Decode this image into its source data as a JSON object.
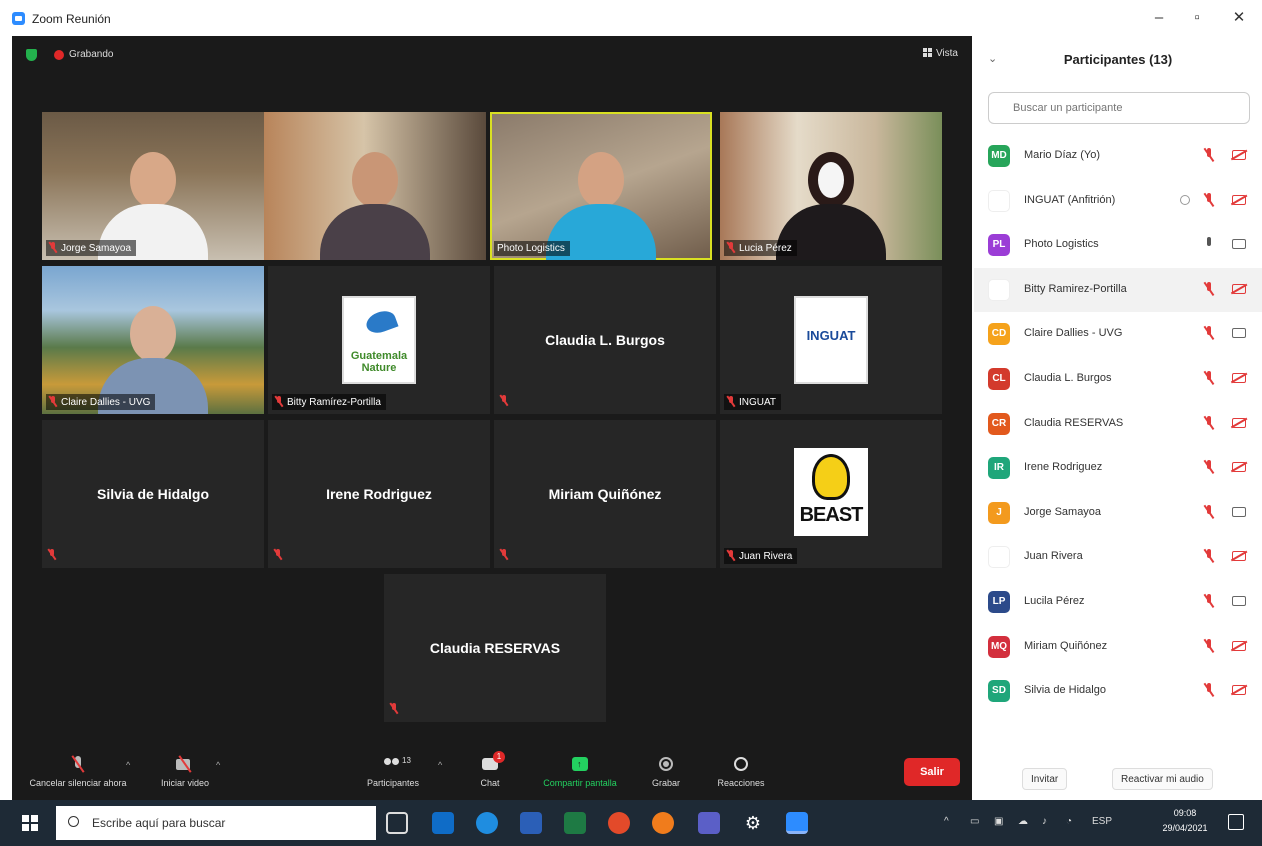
{
  "window": {
    "title": "Zoom Reunión",
    "minimize": "–",
    "restore": "▫",
    "close": "✕"
  },
  "meeting_top": {
    "recording_label": "Grabando",
    "view_label": "Vista"
  },
  "tiles": [
    {
      "name": "Jorge Samayoa",
      "kind": "video"
    },
    {
      "name": "",
      "kind": "video"
    },
    {
      "name": "Photo Logistics",
      "kind": "video",
      "active": true
    },
    {
      "name": "Lucia Pérez",
      "kind": "video"
    },
    {
      "name": "Claire Dallies - UVG",
      "kind": "video"
    },
    {
      "name": "Bitty Ramírez-Portilla",
      "kind": "logo",
      "logo_text": "Guatemala Nature"
    },
    {
      "name": "Claudia L. Burgos",
      "kind": "name"
    },
    {
      "name": "INGUAT",
      "kind": "logo",
      "logo_text": "INGUAT"
    },
    {
      "name": "Silvia de Hidalgo",
      "kind": "name"
    },
    {
      "name": "Irene Rodriguez",
      "kind": "name"
    },
    {
      "name": "Miriam Quiñónez",
      "kind": "name"
    },
    {
      "name": "Juan Rivera",
      "kind": "logo",
      "logo_text": "BEAST"
    },
    {
      "name": "Claudia RESERVAS",
      "kind": "name"
    }
  ],
  "toolbar": {
    "unmute_label": "Cancelar silenciar ahora",
    "video_label": "Iniciar video",
    "participants_label": "Participantes",
    "participants_count": "13",
    "chat_label": "Chat",
    "chat_badge": "1",
    "share_label": "Compartir pantalla",
    "record_label": "Grabar",
    "reactions_label": "Reacciones",
    "leave_label": "Salir"
  },
  "panel": {
    "title": "Participantes (13)",
    "search_placeholder": "Buscar un participante",
    "invite_label": "Invitar",
    "unmute_me_label": "Reactivar mi audio",
    "participants": [
      {
        "initials": "MD",
        "name": "Mario Díaz (Yo)",
        "color": "#27a55a",
        "mic": "off",
        "cam": "off"
      },
      {
        "initials": "",
        "name": "INGUAT (Anfitrión)",
        "color": "#ffffff",
        "mic": "off",
        "cam": "off",
        "host": true
      },
      {
        "initials": "PL",
        "name": "Photo Logistics",
        "color": "#9b3dd6",
        "mic": "on",
        "cam": "on"
      },
      {
        "initials": "",
        "name": "Bitty Ramirez-Portilla",
        "color": "#ffffff",
        "mic": "off",
        "cam": "off"
      },
      {
        "initials": "CD",
        "name": "Claire Dallies - UVG",
        "color": "#f5a21b",
        "mic": "off",
        "cam": "on"
      },
      {
        "initials": "CL",
        "name": "Claudia L. Burgos",
        "color": "#d33a2c",
        "mic": "off",
        "cam": "off"
      },
      {
        "initials": "CR",
        "name": "Claudia RESERVAS",
        "color": "#e2591d",
        "mic": "off",
        "cam": "off"
      },
      {
        "initials": "IR",
        "name": "Irene Rodriguez",
        "color": "#1fa67a",
        "mic": "off",
        "cam": "off"
      },
      {
        "initials": "J",
        "name": "Jorge Samayoa",
        "color": "#f39a1e",
        "mic": "off",
        "cam": "on"
      },
      {
        "initials": "",
        "name": "Juan Rivera",
        "color": "#ffffff",
        "mic": "off",
        "cam": "off"
      },
      {
        "initials": "LP",
        "name": "Lucila Pérez",
        "color": "#2c4a8a",
        "mic": "off",
        "cam": "on"
      },
      {
        "initials": "MQ",
        "name": "Miriam Quiñónez",
        "color": "#d32f3d",
        "mic": "off",
        "cam": "off"
      },
      {
        "initials": "SD",
        "name": "Silvia de Hidalgo",
        "color": "#1fa67a",
        "mic": "off",
        "cam": "off"
      }
    ]
  },
  "taskbar": {
    "search_placeholder": "Escribe aquí para buscar",
    "lang": "ESP",
    "time": "09:08",
    "date": "29/04/2021"
  }
}
